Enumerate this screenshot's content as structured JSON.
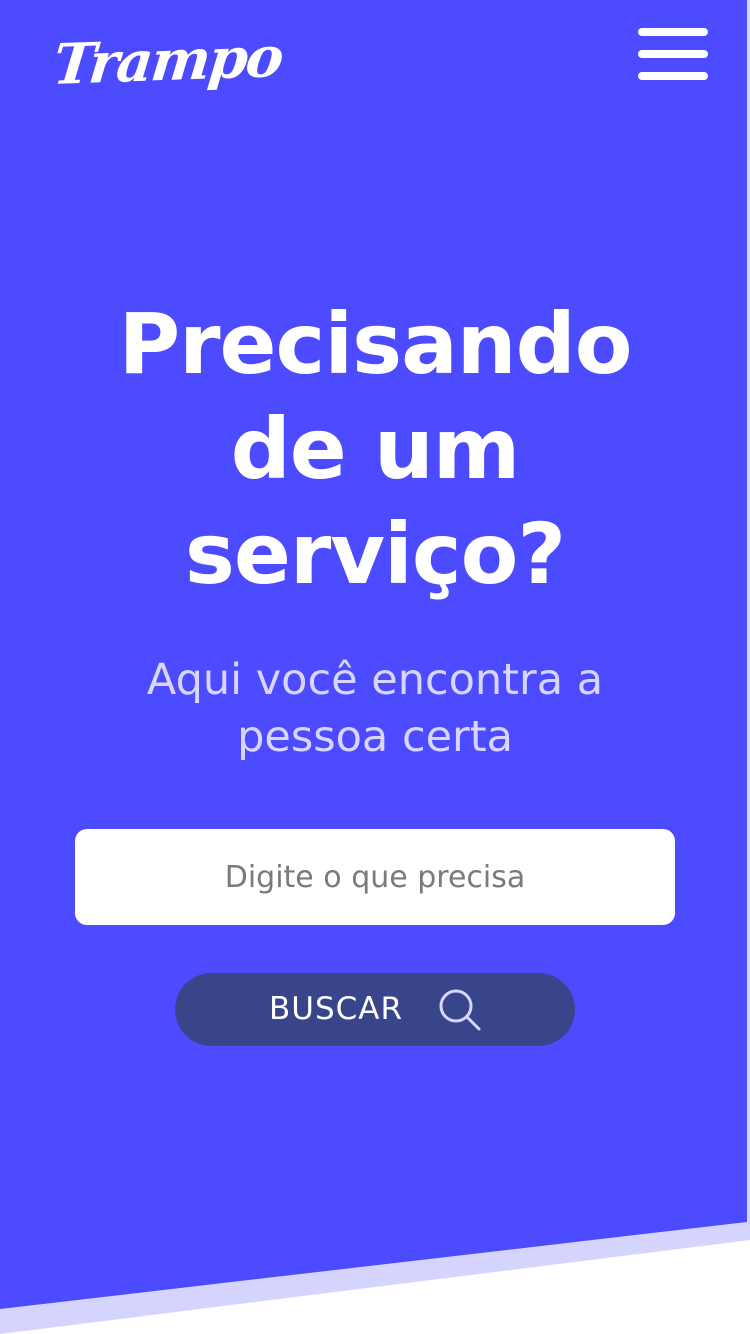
{
  "header": {
    "logo_text": "Trampo",
    "menu_icon": "hamburger-menu-icon"
  },
  "hero": {
    "headline_lines": [
      "Precisando",
      "de um",
      "serviço?"
    ],
    "subtitle_lines": [
      "Aqui você encontra a",
      "pessoa certa"
    ]
  },
  "search": {
    "placeholder": "Digite o que precisa",
    "value": "",
    "button_label": "BUSCAR",
    "button_icon": "search-icon"
  },
  "colors": {
    "hero_background": "#4c4bff",
    "bottom_accent": "#d4d4ff",
    "button_background": "#38458a",
    "page_background": "#ffffff"
  }
}
